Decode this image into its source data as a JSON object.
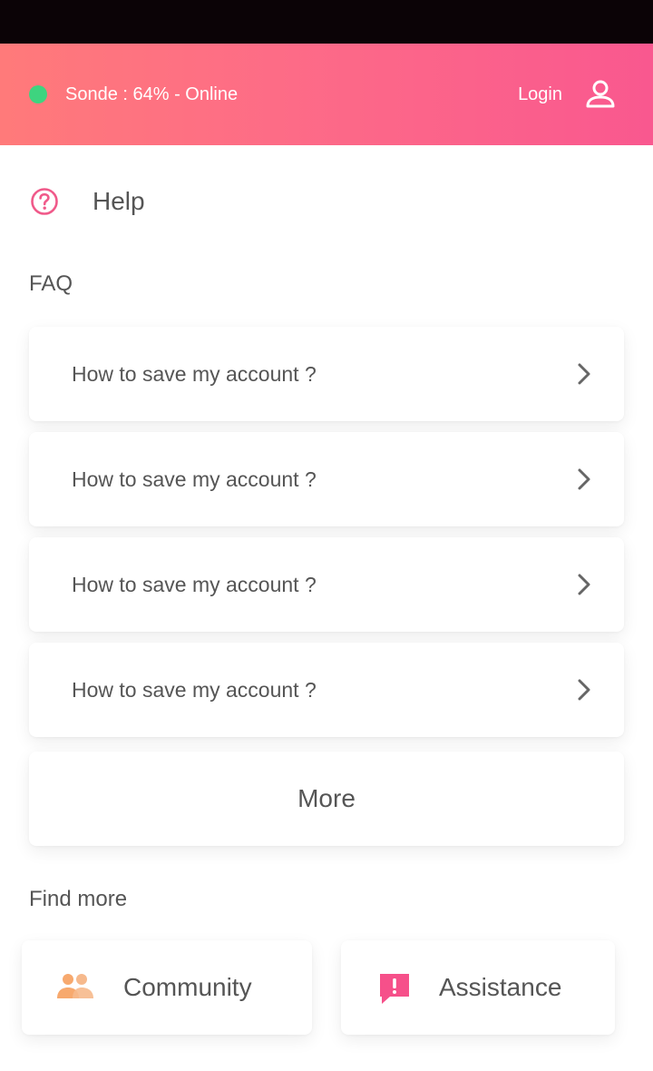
{
  "header": {
    "status_text": "Sonde : 64% - Online",
    "login_label": "Login",
    "status_color": "#3ed47f",
    "gradient_colors": [
      "#ff7a7a",
      "#f9588f"
    ]
  },
  "help": {
    "title": "Help",
    "icon": "question-circle-icon",
    "accent": "#f05a8a"
  },
  "faq": {
    "label": "FAQ",
    "items": [
      {
        "text": "How to save my account ?"
      },
      {
        "text": "How to save my account ?"
      },
      {
        "text": "How to save my account ?"
      },
      {
        "text": "How to save my account ?"
      }
    ],
    "more_label": "More"
  },
  "find_more": {
    "label": "Find more",
    "tiles": [
      {
        "label": "Community",
        "icon": "community-icon"
      },
      {
        "label": "Assistance",
        "icon": "assistance-icon"
      }
    ]
  }
}
